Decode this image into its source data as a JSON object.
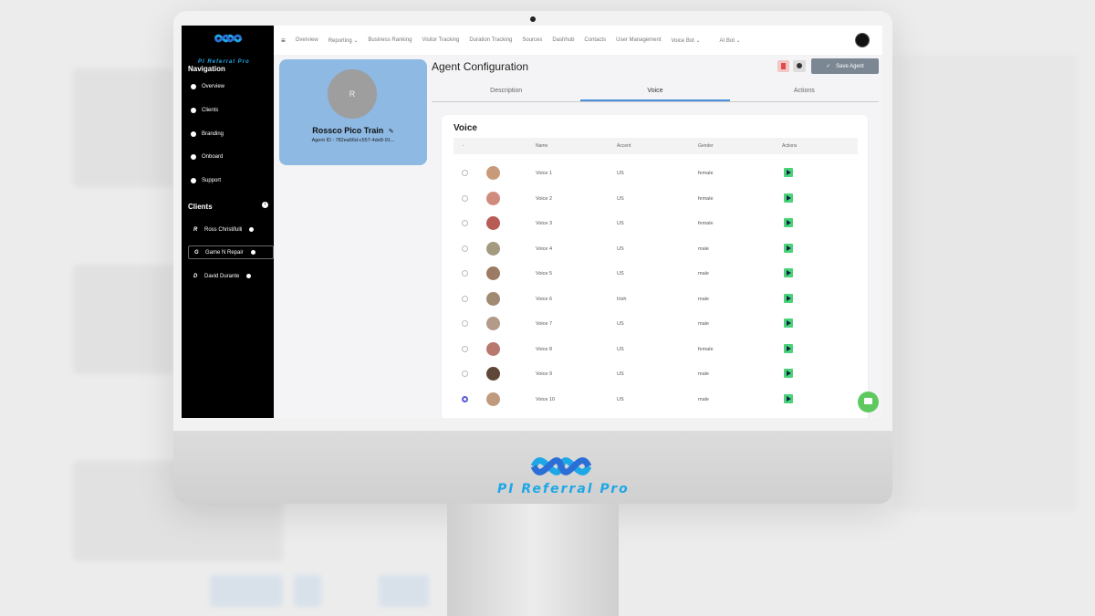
{
  "brand": {
    "name": "PI Referral Pro",
    "accent": "#1ea7e6"
  },
  "sidebar": {
    "navigation_heading": "Navigation",
    "items": [
      {
        "label": "Overview",
        "icon": "pie-chart-icon"
      },
      {
        "label": "Clients",
        "icon": "globe-icon"
      },
      {
        "label": "Branding",
        "icon": "palette-icon"
      },
      {
        "label": "Onboard",
        "icon": "palette-icon"
      },
      {
        "label": "Support",
        "icon": "headset-icon"
      }
    ],
    "clients_heading": "Clients",
    "clients": [
      {
        "initial": "R",
        "name": "Ross Christifulli",
        "active": false
      },
      {
        "initial": "G",
        "name": "Game N Repair",
        "active": true
      },
      {
        "initial": "D",
        "name": "David Durante",
        "active": false
      }
    ]
  },
  "topnav": {
    "items": [
      "Overview",
      "Reporting",
      "Business Ranking",
      "Visitor Tracking",
      "Duration Tracking",
      "Sources",
      "Dashhub",
      "Contacts",
      "User Management",
      "Voice Bot",
      "AI Bot"
    ]
  },
  "agent": {
    "initial": "R",
    "name": "Rossco Pico Train",
    "id_text": "Agent ID : 782ea66d-c557-4de8-91..."
  },
  "config": {
    "title": "Agent Configuration",
    "save_label": "Save Agent",
    "tabs": [
      "Description",
      "Voice",
      "Actions"
    ],
    "active_tab": "Voice"
  },
  "voice": {
    "title": "Voice",
    "columns": [
      "-",
      "Name",
      "Accent",
      "Gender",
      "Actions"
    ],
    "rows": [
      {
        "name": "Voice 1",
        "accent": "US",
        "gender": "female",
        "selected": false,
        "face": "#c89a7a"
      },
      {
        "name": "Voice 2",
        "accent": "US",
        "gender": "female",
        "selected": false,
        "face": "#d18a7e"
      },
      {
        "name": "Voice 3",
        "accent": "US",
        "gender": "female",
        "selected": false,
        "face": "#b85b55"
      },
      {
        "name": "Voice 4",
        "accent": "US",
        "gender": "male",
        "selected": false,
        "face": "#a49a7f"
      },
      {
        "name": "Voice 5",
        "accent": "US",
        "gender": "male",
        "selected": false,
        "face": "#9c7a63"
      },
      {
        "name": "Voice 6",
        "accent": "Irish",
        "gender": "male",
        "selected": false,
        "face": "#a08a72"
      },
      {
        "name": "Voice 7",
        "accent": "US",
        "gender": "male",
        "selected": false,
        "face": "#b39a88"
      },
      {
        "name": "Voice 8",
        "accent": "US",
        "gender": "female",
        "selected": false,
        "face": "#b9786d"
      },
      {
        "name": "Voice 9",
        "accent": "US",
        "gender": "male",
        "selected": false,
        "face": "#5e4638"
      },
      {
        "name": "Voice 10",
        "accent": "US",
        "gender": "male",
        "selected": true,
        "face": "#c09a7c"
      }
    ]
  }
}
